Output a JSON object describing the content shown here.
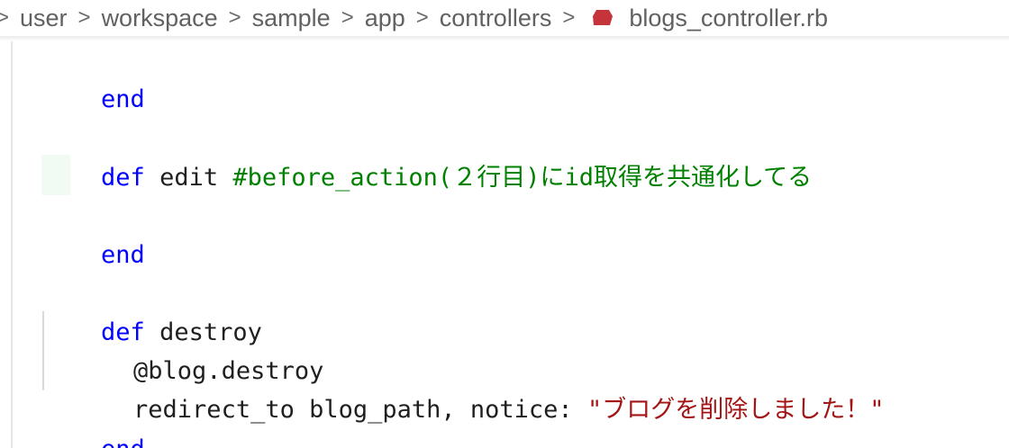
{
  "breadcrumb": {
    "items": [
      "user",
      "workspace",
      "sample",
      "app",
      "controllers"
    ],
    "separator": ">",
    "file": "blogs_controller.rb",
    "file_icon": "ruby-icon"
  },
  "colors": {
    "keyword": "#0000ff",
    "comment": "#008000",
    "string": "#a31515",
    "text": "#1f1f1f",
    "ruby_icon": "#c4343a"
  },
  "code": {
    "line1": {
      "kw": "end"
    },
    "line2": {
      "kw": "def",
      "name": " edit ",
      "comment": "#before_action(２行目)にid取得を共通化してる"
    },
    "line3": {
      "kw": "end"
    },
    "line4": {
      "kw": "def",
      "name": " destroy"
    },
    "line5": {
      "text": "@blog.destroy"
    },
    "line6": {
      "text": "redirect_to blog_path, notice: ",
      "string": "\"ブログを削除しました！\""
    },
    "line7": {
      "kw": "end"
    }
  }
}
